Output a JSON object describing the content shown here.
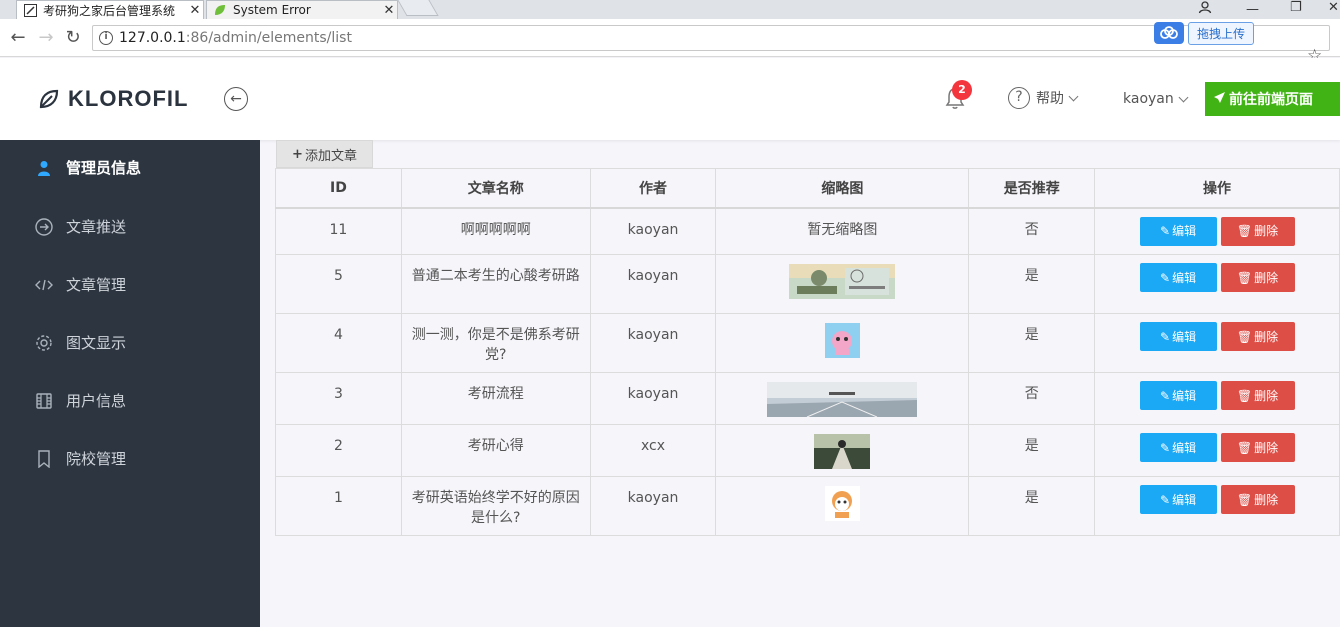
{
  "browser": {
    "tabs": [
      {
        "title": "考研狗之家后台管理系统",
        "active": true
      },
      {
        "title": "System Error",
        "active": false
      }
    ],
    "url_host": "127.0.0.1",
    "url_rest": ":86/admin/elements/list",
    "upload_label": "拖拽上传"
  },
  "header": {
    "brand": "KLOROFIL",
    "notification_count": "2",
    "help_label": "帮助",
    "user_label": "kaoyan",
    "goto_label": "前往前端页面"
  },
  "sidebar": {
    "items": [
      {
        "label": "管理员信息",
        "icon": "user-icon",
        "active": true
      },
      {
        "label": "文章推送",
        "icon": "arrow-right-circle-icon",
        "active": false
      },
      {
        "label": "文章管理",
        "icon": "code-icon",
        "active": false
      },
      {
        "label": "图文显示",
        "icon": "gear-icon",
        "active": false
      },
      {
        "label": "用户信息",
        "icon": "film-icon",
        "active": false
      },
      {
        "label": "院校管理",
        "icon": "bookmark-icon",
        "active": false
      }
    ]
  },
  "content": {
    "add_label": "添加文章",
    "columns": [
      "ID",
      "文章名称",
      "作者",
      "缩略图",
      "是否推荐",
      "操作"
    ],
    "rows": [
      {
        "id": "11",
        "title": "啊啊啊啊啊",
        "author": "kaoyan",
        "thumb": "暂无缩略图",
        "recommend": "否"
      },
      {
        "id": "5",
        "title": "普通二本考生的心酸考研路",
        "author": "kaoyan",
        "thumb": "",
        "recommend": "是"
      },
      {
        "id": "4",
        "title": "测一测，你是不是佛系考研党?",
        "author": "kaoyan",
        "thumb": "",
        "recommend": "是"
      },
      {
        "id": "3",
        "title": "考研流程",
        "author": "kaoyan",
        "thumb": "",
        "recommend": "否"
      },
      {
        "id": "2",
        "title": "考研心得",
        "author": "xcx",
        "thumb": "",
        "recommend": "是"
      },
      {
        "id": "1",
        "title": "考研英语始终学不好的原因是什么?",
        "author": "kaoyan",
        "thumb": "",
        "recommend": "是"
      }
    ],
    "edit_label": "编辑",
    "delete_label": "删除"
  },
  "colors": {
    "sidebar_bg": "#2d3540",
    "edit_button": "#1ba8f5",
    "delete_button": "#dd4e47",
    "goto_button": "#41b314",
    "badge": "#f3363e"
  }
}
